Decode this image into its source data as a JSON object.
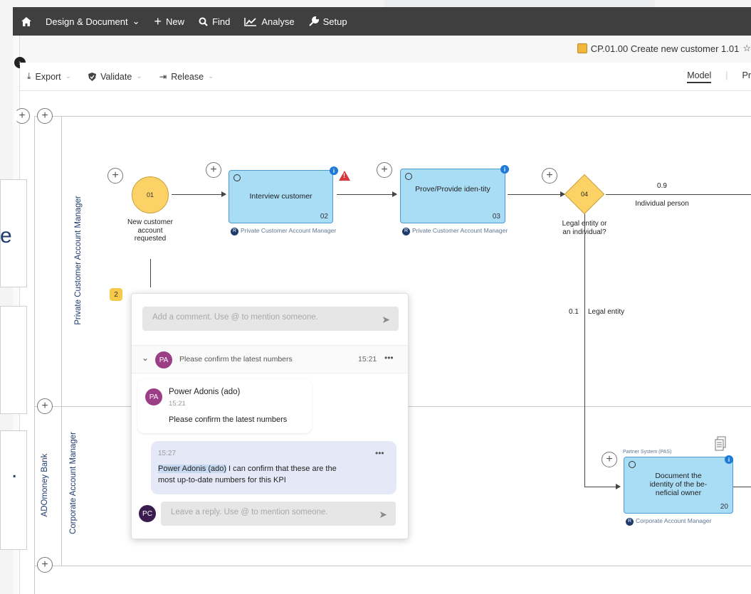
{
  "topnav": {
    "home_icon": "home-icon",
    "items": [
      {
        "label": "Design & Document",
        "caret": "⌄"
      },
      {
        "label": "New",
        "icon": "plus-icon"
      },
      {
        "label": "Find",
        "icon": "search-icon"
      },
      {
        "label": "Analyse",
        "icon": "chart-icon"
      },
      {
        "label": "Setup",
        "icon": "wrench-icon"
      }
    ],
    "bg_color": "#3f3f3f"
  },
  "document": {
    "title": "CP.01.00 Create new customer 1.01",
    "star": "☆"
  },
  "toolbar": {
    "export": "Export",
    "validate": "Validate",
    "release": "Release",
    "view_model": "Model",
    "view_other": "Pr"
  },
  "lanes": {
    "private": "Private Customer Account Manager",
    "corporate": "Corporate Account Manager",
    "pool": "ADOmoney Bank"
  },
  "nodes": {
    "start_event": {
      "num": "01",
      "label": "New customer account requested"
    },
    "task02": {
      "title": "Interview customer",
      "num": "02",
      "role": "Private Customer Account Manager"
    },
    "task03": {
      "title": "Prove/Provide iden-tity",
      "num": "03",
      "role": "Private Customer Account Manager"
    },
    "gateway04": {
      "num": "04",
      "label": "Legal entity or an individual?"
    },
    "task20": {
      "title": "Document the identity of the be-neficial owner",
      "num": "20",
      "system": "Partner System (PAS)",
      "role": "Corporate Account Manager"
    }
  },
  "flows": {
    "individual_prob": "0.9",
    "individual_label": "Individual person",
    "legal_prob": "0.1",
    "legal_label": "Legal entity"
  },
  "comment_badge": "2",
  "comments": {
    "input_placeholder": "Add a comment. Use @ to mention someone.",
    "thread": {
      "initials": "PA",
      "title": "Please confirm the latest numbers",
      "time": "15:21",
      "more": "•••"
    },
    "msg1": {
      "initials": "PA",
      "author": "Power Adonis (ado)",
      "time": "15:21",
      "text": "Please confirm the latest numbers"
    },
    "msg2": {
      "time": "15:27",
      "more": "•••",
      "mention": "Power Adonis (ado)",
      "text_after_mention": " I can confirm that these are the",
      "text_line2": "most up-to-date numbers for this KPI"
    },
    "reply": {
      "initials": "PC",
      "placeholder": "Leave a reply. Use @ to mention someone."
    }
  },
  "left_peek": {
    "char1": "e",
    "char2": "."
  },
  "colors": {
    "task_fill": "#a9dcf5",
    "event_fill": "#fcd166",
    "avatar_pa": "#9b3e86",
    "avatar_pc": "#3a1c4f"
  }
}
